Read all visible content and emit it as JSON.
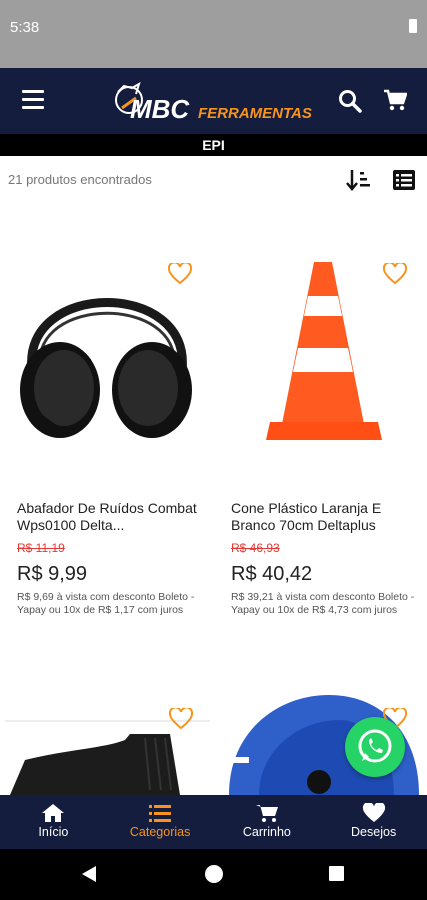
{
  "status": {
    "time": "5:38"
  },
  "header": {
    "logo_main": "MBC",
    "logo_sub": "FERRAMENTAS",
    "category": "EPI"
  },
  "list": {
    "count": "21 produtos encontrados"
  },
  "products": [
    {
      "title": "Abafador De Ruídos Combat Wps0100 Delta...",
      "old_price": "R$ 11,19",
      "price": "R$ 9,99",
      "note": "R$ 9,69 à vista com desconto Boleto - Yapay ou 10x de R$ 1,17 com juros"
    },
    {
      "title": "Cone Plástico Laranja E Branco 70cm Deltaplus",
      "old_price": "R$ 46,93",
      "price": "R$ 40,42",
      "note": "R$ 39,21 à vista com desconto Boleto - Yapay ou 10x de R$ 4,73 com juros"
    }
  ],
  "bottom_nav": [
    {
      "label": "Início",
      "icon": "home-icon"
    },
    {
      "label": "Categorias",
      "icon": "list-icon"
    },
    {
      "label": "Carrinho",
      "icon": "cart-icon"
    },
    {
      "label": "Desejos",
      "icon": "heart-icon"
    }
  ],
  "colors": {
    "header_bg": "#141d3d",
    "accent": "#f7941d",
    "old_price": "#e53935",
    "whatsapp": "#25d366"
  }
}
